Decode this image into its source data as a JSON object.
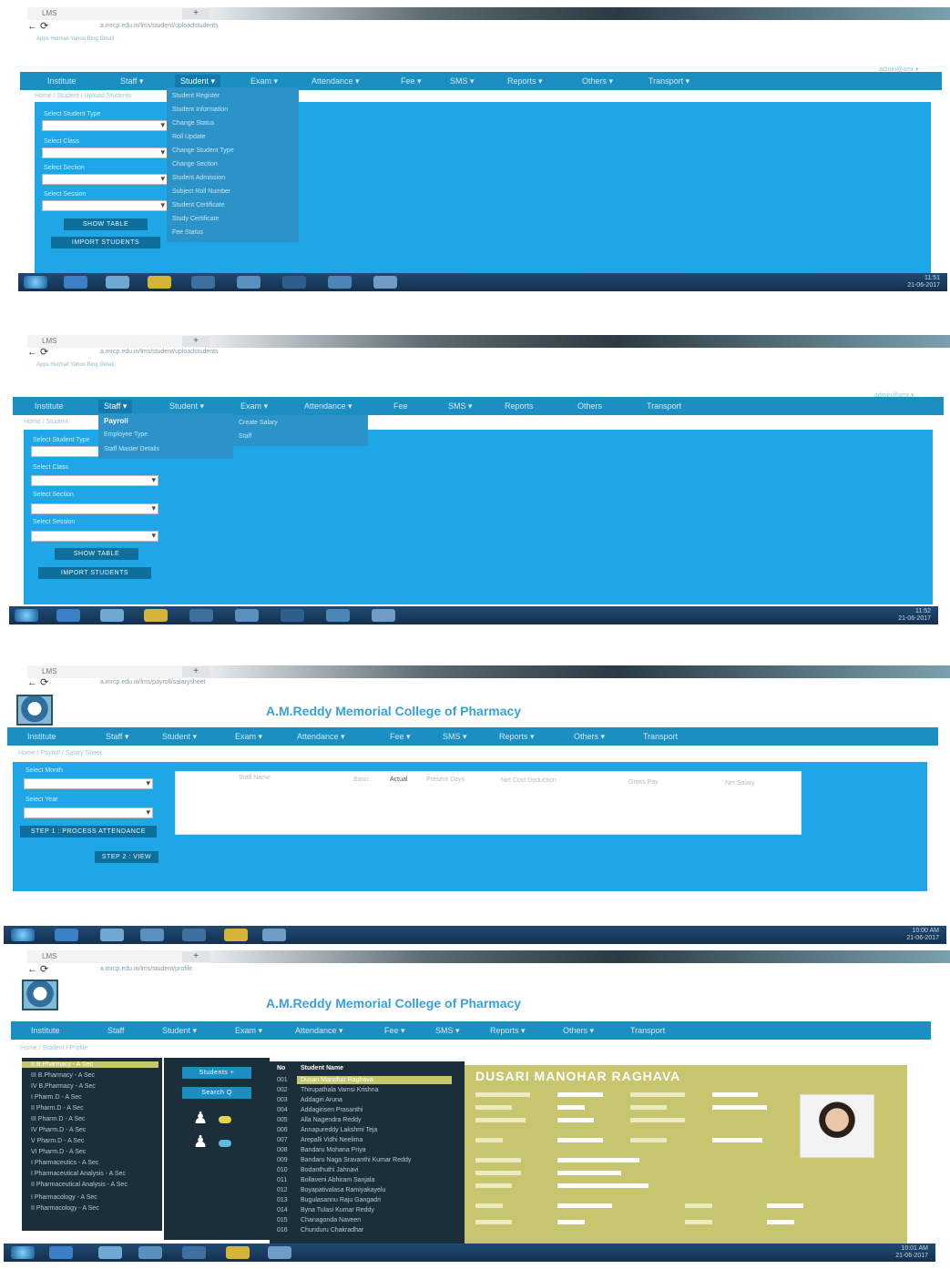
{
  "browser": {
    "tab_title": "LMS",
    "new_tab": "+",
    "nav_icons": "←  ⟳"
  },
  "panels": [
    {
      "address": "a.mrcp.edu.in/lms/student/uploadstudents",
      "bookmarks": "Apps  Hotmail  Yahoo  Bing  Gmail",
      "user": "admin@amr ▾",
      "nav": [
        "Institute",
        "Staff ▾",
        "Student ▾",
        "Exam ▾",
        "Attendance ▾",
        "Fee ▾",
        "SMS ▾",
        "Reports ▾",
        "Others ▾",
        "Transport ▾"
      ],
      "crumb": "Home  /  Student  /  Upload Students",
      "menu_items": [
        "Student Register",
        "Student Information",
        "Change Status",
        "Roll Update",
        "Change Student Type",
        "Change Section",
        "Student Admission",
        "Subject Roll Number",
        "Student Certificate",
        "Study Certificate",
        "Fee Status"
      ],
      "form": [
        {
          "label": "Select Student Type"
        },
        {
          "label": "Select Class"
        },
        {
          "label": "Select Section"
        },
        {
          "label": "Select Session"
        }
      ],
      "buttons": [
        "SHOW TABLE",
        "IMPORT STUDENTS"
      ],
      "clock": {
        "time": "11:51",
        "date": "21-06-2017"
      }
    },
    {
      "address": "a.mrcp.edu.in/lms/student/uploadstudents",
      "bookmarks": "Apps  Hotmail  Yahoo  Bing  Gmail",
      "user": "admin@amr ▾",
      "nav": [
        "Institute",
        "Staff ▾",
        "Student ▾",
        "Exam ▾",
        "Attendance ▾",
        "Fee",
        "SMS ▾",
        "Reports",
        "Others",
        "Transport"
      ],
      "crumb": "Home  /  Student",
      "submenu_title": "Payroll",
      "menu_items": [
        "Employee Type",
        "Staff Master Details"
      ],
      "submenu_right": [
        "Create Salary",
        "Staff"
      ],
      "form": [
        {
          "label": "Select Student Type"
        },
        {
          "label": "Select Class"
        },
        {
          "label": "Select Section"
        },
        {
          "label": "Select Session"
        }
      ],
      "buttons": [
        "SHOW TABLE",
        "IMPORT STUDENTS"
      ],
      "clock": {
        "time": "11:52",
        "date": "21-06-2017"
      }
    },
    {
      "address": "a.mrcp.edu.in/lms/payroll/salarysheet",
      "college": "A.M.Reddy Memorial College of Pharmacy",
      "nav": [
        "Institute",
        "Staff ▾",
        "Student ▾",
        "Exam ▾",
        "Attendance ▾",
        "Fee ▾",
        "SMS ▾",
        "Reports ▾",
        "Others ▾",
        "Transport"
      ],
      "crumb": "Home  /  Payroll  /  Salary Sheet",
      "form": [
        {
          "label": "Select Month"
        },
        {
          "label": "Select Year"
        }
      ],
      "buttons": [
        "STEP 1 : PROCESS ATTENDANCE",
        "STEP 2 : VIEW"
      ],
      "columns": [
        "Staff Name",
        "Basic",
        "Actual",
        "Present Days",
        "Net Cost Deduction",
        "Gross Pay",
        "Net Salary"
      ],
      "clock": {
        "time": "10:00 AM",
        "date": "21-06-2017"
      }
    },
    {
      "address": "a.mrcp.edu.in/lms/student/profile",
      "college": "A.M.Reddy Memorial College of Pharmacy",
      "nav": [
        "Institute",
        "Staff",
        "Student ▾",
        "Exam ▾",
        "Attendance ▾",
        "Fee ▾",
        "SMS ▾",
        "Reports ▾",
        "Others ▾",
        "Transport"
      ],
      "crumb": "Home  /  Student  /  Profile",
      "classes": [
        "II B.Pharmacy - A Sec",
        "III B.Pharmacy - A Sec",
        "IV B.Pharmacy - A Sec",
        "I Pharm.D - A Sec",
        "II Pharm.D - A Sec",
        "III Pharm.D - A Sec",
        "IV Pharm.D - A Sec",
        "V Pharm.D - A Sec",
        "VI Pharm.D - A Sec",
        "I Pharmaceutics - A Sec",
        "I Pharmaceutical Analysis - A Sec",
        "II Pharmaceutical Analysis - A Sec",
        "I Pharmacology - A Sec",
        "II Pharmacology - A Sec"
      ],
      "actions": [
        "Students +",
        "Search Q"
      ],
      "student_header": {
        "no": "No",
        "name": "Student Name"
      },
      "students": [
        {
          "no": "001",
          "name": "Dusari Manohar Raghava"
        },
        {
          "no": "002",
          "name": "Thirupathala Vamsi Krishna"
        },
        {
          "no": "003",
          "name": "Addagiri Aruna"
        },
        {
          "no": "004",
          "name": "Addagirisen Prasanthi"
        },
        {
          "no": "005",
          "name": "Alla Nagendra Reddy"
        },
        {
          "no": "006",
          "name": "Annapureddy Lakshmi Teja"
        },
        {
          "no": "007",
          "name": "Arepalli Vidhi Neelima"
        },
        {
          "no": "008",
          "name": "Bandaru Mohana Priya"
        },
        {
          "no": "009",
          "name": "Bandaru Naga Sravanthi Kumar Reddy"
        },
        {
          "no": "010",
          "name": "Bodanthuthi Jahnavi"
        },
        {
          "no": "011",
          "name": "Bollaveni Abhiram Sanjala"
        },
        {
          "no": "012",
          "name": "Boyapativalasa Ramiyakayelu"
        },
        {
          "no": "013",
          "name": "Bugulasannu Raju Gangadri"
        },
        {
          "no": "014",
          "name": "Byna Tulasi Kumar Reddy"
        },
        {
          "no": "015",
          "name": "Chanagonda Naveen"
        },
        {
          "no": "016",
          "name": "Chunduru Chakradhar"
        }
      ],
      "profile_name": "DUSARI MANOHAR RAGHAVA",
      "clock": {
        "time": "10:01 AM",
        "date": "21-06-2017"
      }
    }
  ],
  "colors": {
    "nav": "#1b8fc1",
    "panel": "#1fa6e6",
    "dark": "#1b2f3b",
    "profile": "#c7c56d"
  }
}
